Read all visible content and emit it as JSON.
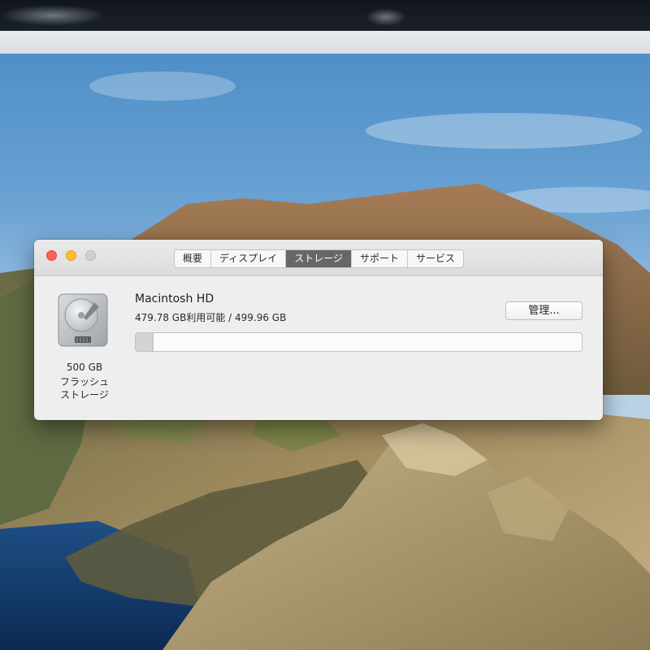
{
  "window": {
    "tabs": [
      {
        "label": "概要",
        "active": false
      },
      {
        "label": "ディスプレイ",
        "active": false
      },
      {
        "label": "ストレージ",
        "active": true
      },
      {
        "label": "サポート",
        "active": false
      },
      {
        "label": "サービス",
        "active": false
      }
    ]
  },
  "storage": {
    "drive_caption": [
      "500 GB",
      "フラッシュ",
      "ストレージ"
    ],
    "volume_name": "Macintosh HD",
    "availability_text": "479.78 GB利用可能 / 499.96 GB",
    "manage_label": "管理...",
    "used_fraction": 0.04
  },
  "colors": {
    "close": "#fe5f57",
    "minimize": "#febc2e",
    "zoom_inactive": "#d0d0d0",
    "active_tab": "#676767"
  },
  "icons": {
    "drive": "hard-drive-icon"
  }
}
